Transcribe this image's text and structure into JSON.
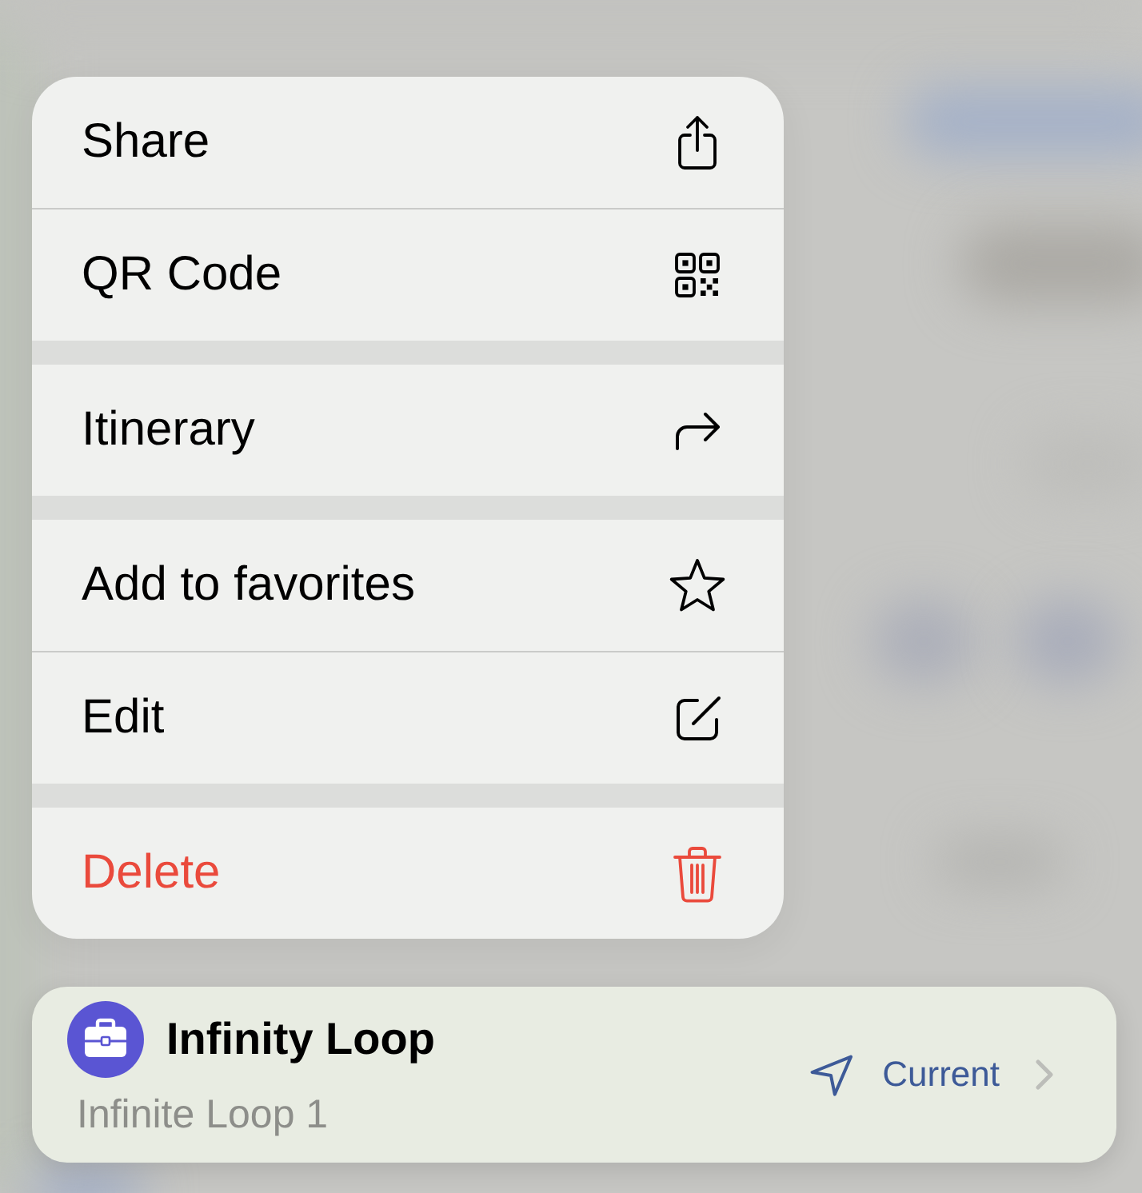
{
  "menu": {
    "groups": [
      {
        "items": [
          {
            "kind": "share",
            "label": "Share",
            "destructive": false
          },
          {
            "kind": "qr",
            "label": "QR Code",
            "destructive": false
          }
        ]
      },
      {
        "items": [
          {
            "kind": "route",
            "label": "Itinerary",
            "destructive": false
          }
        ]
      },
      {
        "items": [
          {
            "kind": "favorite",
            "label": "Add to favorites",
            "destructive": false
          },
          {
            "kind": "edit",
            "label": "Edit",
            "destructive": false
          }
        ]
      },
      {
        "items": [
          {
            "kind": "delete",
            "label": "Delete",
            "destructive": true
          }
        ]
      }
    ]
  },
  "place_card": {
    "title": "Infinity Loop",
    "address": "Infinite Loop 1",
    "location_label": "Current"
  }
}
